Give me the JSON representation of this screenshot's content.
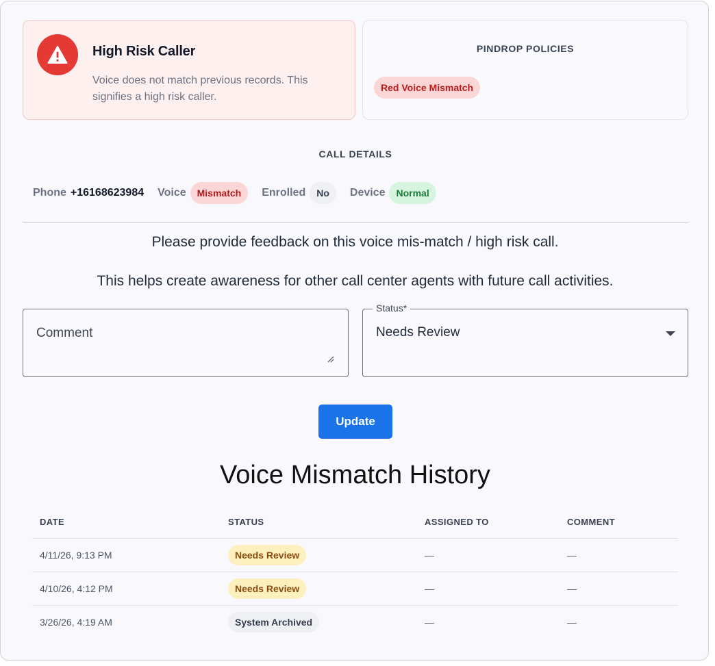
{
  "alert": {
    "icon": "warning-icon",
    "title": "High Risk Caller",
    "message": "Voice does not match previous records. This signifies a high risk caller."
  },
  "policies": {
    "heading": "PINDROP POLICIES",
    "items": [
      {
        "label": "Red Voice Mismatch",
        "color": "#b71c1c"
      }
    ]
  },
  "call_details": {
    "heading": "CALL DETAILS",
    "phone_label": "Phone",
    "phone_value": "+16168623984",
    "voice_label": "Voice",
    "voice_value": "Mismatch",
    "enrolled_label": "Enrolled",
    "enrolled_value": "No",
    "device_label": "Device",
    "device_value": "Normal"
  },
  "feedback": {
    "prompt_1": "Please provide feedback on this voice mis-match / high risk call.",
    "prompt_2": "This helps create awareness for other call center agents with future call activities.",
    "comment_placeholder": "Comment",
    "status_label": "Status*",
    "status_value": "Needs Review",
    "update_label": "Update"
  },
  "history": {
    "title": "Voice Mismatch History",
    "columns": [
      "DATE",
      "STATUS",
      "ASSIGNED TO",
      "COMMENT"
    ],
    "rows": [
      {
        "date": "4/11/26, 9:13 PM",
        "status": "Needs Review",
        "assigned_to": "—",
        "comment": "—"
      },
      {
        "date": "4/10/26, 4:12 PM",
        "status": "Needs Review",
        "assigned_to": "—",
        "comment": "—"
      },
      {
        "date": "3/26/26, 4:19 AM",
        "status": "System Archived",
        "assigned_to": "—",
        "comment": "—"
      }
    ]
  },
  "colors": {
    "accent": "#1a73e8",
    "danger": "#e53935",
    "success": "#1b7a3a",
    "warning": "#8a4b0f"
  }
}
